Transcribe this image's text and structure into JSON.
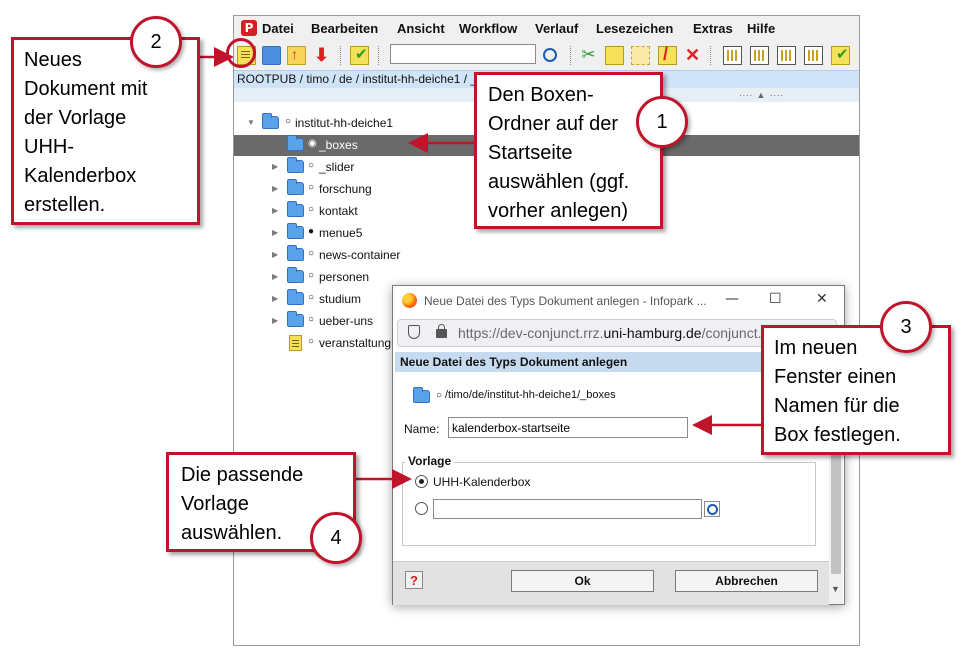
{
  "menubar": {
    "items": [
      "Datei",
      "Bearbeiten",
      "Ansicht",
      "Workflow",
      "Verlauf",
      "Lesezeichen",
      "Extras",
      "Hilfe"
    ],
    "logo_letter": "P"
  },
  "toolbar": {
    "search_value": "",
    "icons": [
      "new-document-icon",
      "new-folder-icon",
      "upload-icon",
      "download-icon",
      "release-icon",
      "search-icon",
      "cut-icon",
      "copy-icon",
      "paste-icon",
      "no-document-icon",
      "delete-icon",
      "view-icon"
    ]
  },
  "pathbar": {
    "text": "ROOTPUB / timo / de / institut-hh-deiche1 / _"
  },
  "tree": {
    "root": {
      "label": "institut-hh-deiche1",
      "marker": "○"
    },
    "items": [
      {
        "label": "_boxes",
        "marker": "◉",
        "type": "folder",
        "selected": true
      },
      {
        "label": "_slider",
        "marker": "○",
        "type": "folder"
      },
      {
        "label": "forschung",
        "marker": "○",
        "type": "folder"
      },
      {
        "label": "kontakt",
        "marker": "○",
        "type": "folder"
      },
      {
        "label": "menue5",
        "marker": "●",
        "type": "folder"
      },
      {
        "label": "news-container",
        "marker": "○",
        "type": "folder"
      },
      {
        "label": "personen",
        "marker": "○",
        "type": "folder"
      },
      {
        "label": "studium",
        "marker": "○",
        "type": "folder"
      },
      {
        "label": "ueber-uns",
        "marker": "○",
        "type": "folder"
      },
      {
        "label": "veranstaltung",
        "marker": "○",
        "type": "document"
      }
    ]
  },
  "dialog": {
    "window_title": "Neue Datei des Typs Dokument anlegen - Infopark ...",
    "url_prefix": "https://dev-conjunct.rrz.",
    "url_domain": "uni-hamburg.de",
    "url_suffix": "/conjunct...",
    "header": "Neue Datei des Typs Dokument anlegen",
    "path_marker": "○",
    "path": "/timo/de/institut-hh-deiche1/_boxes",
    "name_label": "Name:",
    "name_value": "kalenderbox-startseite",
    "template_group_label": "Vorlage",
    "template_option": "UHH-Kalenderbox",
    "template_option_selected": true,
    "template_custom_value": "",
    "help_label": "?",
    "ok_label": "Ok",
    "cancel_label": "Abbrechen",
    "minimize_glyph": "—",
    "maximize_glyph": "☐",
    "close_glyph": "✕"
  },
  "annotations": {
    "step1": {
      "number": "1",
      "text_lines": [
        "Den Boxen-",
        "Ordner auf der",
        "Startseite",
        "auswählen (ggf.",
        "vorher anlegen)"
      ]
    },
    "step2": {
      "number": "2",
      "text_lines": [
        "Neues",
        "Dokument mit",
        "der Vorlage",
        "UHH-",
        "Kalenderbox",
        "erstellen."
      ]
    },
    "step3": {
      "number": "3",
      "text_lines": [
        "Im neuen",
        "Fenster einen",
        "Namen für die",
        "Box festlegen."
      ]
    },
    "step4": {
      "number": "4",
      "text_lines": [
        "Die passende",
        "Vorlage",
        "auswählen."
      ]
    },
    "accent_color": "#c0142b"
  },
  "colors": {
    "selection": "#6a6a6a",
    "pathbar": "#cfe4f7",
    "dialog_header": "#c7dbf0",
    "folder": "#5aa2ea"
  }
}
